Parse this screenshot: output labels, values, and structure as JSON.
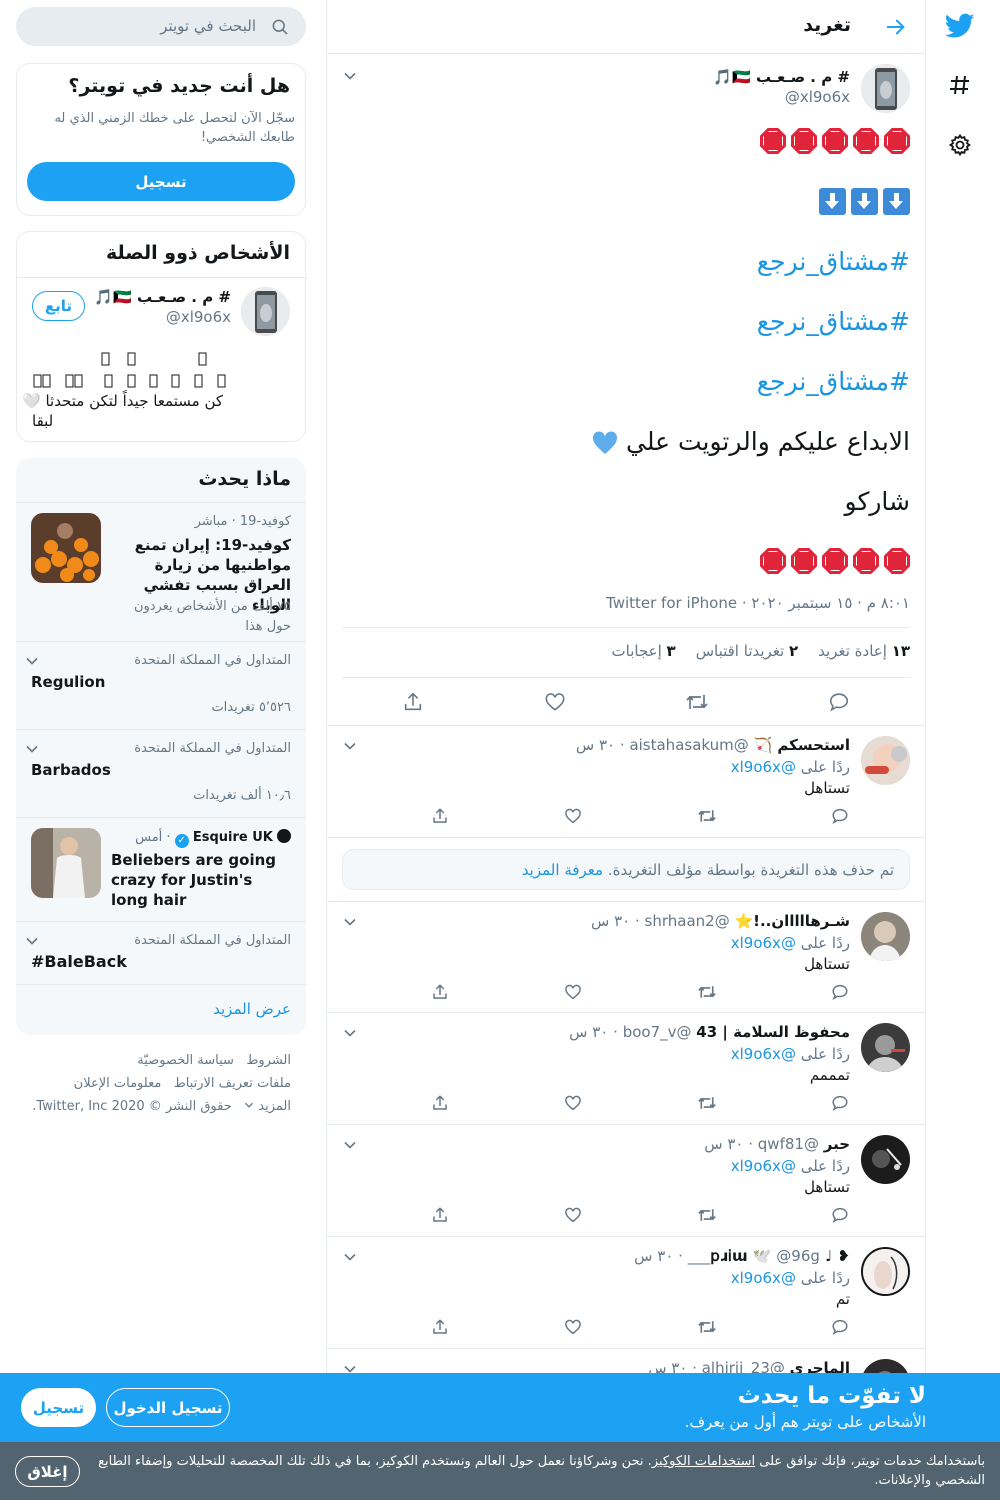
{
  "header": {
    "title": "تغريد"
  },
  "tweet": {
    "author_name": "# م . صـعـب 🇰🇼🎵",
    "author_handle": "@xl9o6x",
    "hashtags": [
      "#مشتاق_نرجع",
      "#مشتاق_نرجع",
      "#مشتاق_نرجع"
    ],
    "line_thanks": "الابداع عليكم والرتويت علي",
    "line_share": "شاركو",
    "meta": "٨:٠١ م · ١٥ سبتمبر ٢٠٢٠ · Twitter for iPhone",
    "retweets_num": "١٣",
    "retweets_label": "إعادة تغريد",
    "quotes_num": "٢",
    "quotes_label": "تغريدتا اقتباس",
    "likes_num": "٣",
    "likes_label": "إعجابات"
  },
  "replies": [
    {
      "name": "استحسكم 🏹",
      "handle": "@aistahasakum",
      "time": "· ٣٠ س",
      "replying_prefix": "ردًا على",
      "replying_to": "@xl9o6x",
      "text": "تستاهل"
    },
    {
      "name": "شـرهااااان..!⭐",
      "handle": "@shrhaan2",
      "time": "· ٣٠ س",
      "replying_prefix": "ردًا على",
      "replying_to": "@xl9o6x",
      "text": "تستاهل"
    },
    {
      "name": "محفوظ السلامة | 43",
      "handle": "@boo7_v",
      "time": "· ٣٠ س",
      "replying_prefix": "ردًا على",
      "replying_to": "@xl9o6x",
      "text": "تمممم"
    },
    {
      "name": "حبر",
      "handle": "@qwf81",
      "time": "· ٣٠ س",
      "replying_prefix": "ردًا على",
      "replying_to": "@xl9o6x",
      "text": "تستاهل"
    },
    {
      "name": "❥ ♩ 𝗉ɹ𝗂ɯ 🕊️",
      "handle": "@96g___",
      "time": "· ٣٠ س",
      "replying_prefix": "ردًا على",
      "replying_to": "@xl9o6x",
      "text": "تم"
    },
    {
      "name": "الماجري",
      "handle": "@alhirji_23",
      "time": "· ٣٠ س"
    }
  ],
  "deleted_notice": {
    "text": "تم حذف هذه التغريدة بواسطة مؤلف التغريدة.",
    "link": "معرفة المزيد"
  },
  "search": {
    "placeholder": "البحث في تويتر"
  },
  "new_card": {
    "title": "هل أنت جديد في تويتر؟",
    "desc": "سجّل الآن لتحصل على خطك الزمني الذي له طابعك الشخصي!",
    "button": "تسجيل"
  },
  "related": {
    "title": "الأشخاص ذوو الصلة",
    "name": "# م . صـعـب 🇰🇼🎵",
    "handle": "@xl9o6x",
    "follow": "تابع",
    "bio_line1": "كن مستمعا جيداً لتكن متحدثا 🤍",
    "bio_line2": "لبقا"
  },
  "trends": {
    "title": "ماذا يحدث",
    "items": [
      {
        "meta": "كوفيد-19 · مباشر",
        "title": "كوفيد-19: إيران تمنع مواطنيها من زيارة العراق بسبب تفشي الوباء",
        "count": "٧٥ ألف من الأشخاص يغردون حول هذا"
      },
      {
        "meta": "المتداول في المملكة المتحدة",
        "title": "Regulion",
        "count": "٥٬٥٢٦ تغريدات"
      },
      {
        "meta": "المتداول في المملكة المتحدة",
        "title": "Barbados",
        "count": "١٠٫٦ ألف تغريدات"
      },
      {
        "meta_name": "Esquire UK",
        "meta_time": "· أمس",
        "title": "Beliebers are going crazy for Justin's long hair"
      },
      {
        "meta": "المتداول في المملكة المتحدة",
        "title": "#BaleBack"
      }
    ],
    "show_more": "عرض المزيد"
  },
  "footer": {
    "terms": "الشروط",
    "privacy": "سياسة الخصوصيّة",
    "cookies": "ملفات تعريف الارتباط",
    "ads": "معلومات الإعلان",
    "more": "المزيد",
    "copyright": "حقوق النشر © 2020 Twitter, Inc."
  },
  "banner": {
    "title": "لا تفوّت ما يحدث",
    "subtitle": "الأشخاص على تويتر هم أول من يعرف.",
    "login": "تسجيل الدخول",
    "signup": "تسجيل"
  },
  "cookie": {
    "text_before": "باستخدامك خدمات تويتر، فإنك توافق على ",
    "link": "استخدامات الكوكيز",
    "text_after": ". نحن وشركاؤنا نعمل حول العالم ونستخدم الكوكيز، بما في ذلك تلك المخصصة للتحليلات وإضفاء الطابع الشخصي والإعلانات.",
    "close": "إغلاق"
  },
  "colors": {
    "brand": "#1da1f2",
    "link": "#1b95e0",
    "muted": "#657786",
    "cookie_bg": "#536471"
  }
}
